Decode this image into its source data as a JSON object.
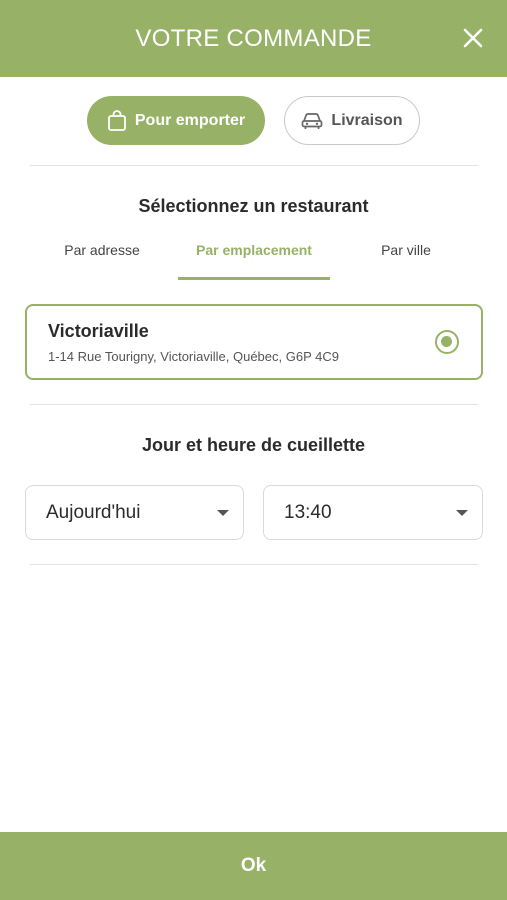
{
  "header": {
    "title": "VOTRE COMMANDE",
    "close_icon": "close-icon"
  },
  "order_mode": {
    "takeout_label": "Pour emporter",
    "takeout_icon": "shopping-bag-icon",
    "delivery_label": "Livraison",
    "delivery_icon": "car-icon",
    "selected": "Pour emporter"
  },
  "restaurant_section": {
    "title": "Sélectionnez un restaurant",
    "tabs": [
      {
        "label": "Par adresse"
      },
      {
        "label": "Par emplacement"
      },
      {
        "label": "Par ville"
      }
    ],
    "active_tab": "Par emplacement",
    "selected_restaurant": {
      "name": "Victoriaville",
      "address": "1-14 Rue Tourigny, Victoriaville, Québec, G6P 4C9"
    }
  },
  "pickup_section": {
    "title": "Jour et heure de cueillette",
    "day_value": "Aujourd'hui",
    "time_value": "13:40"
  },
  "footer": {
    "ok_label": "Ok"
  },
  "colors": {
    "accent": "#97b267",
    "text": "#2b2b2b",
    "border": "#d9d9d9"
  }
}
